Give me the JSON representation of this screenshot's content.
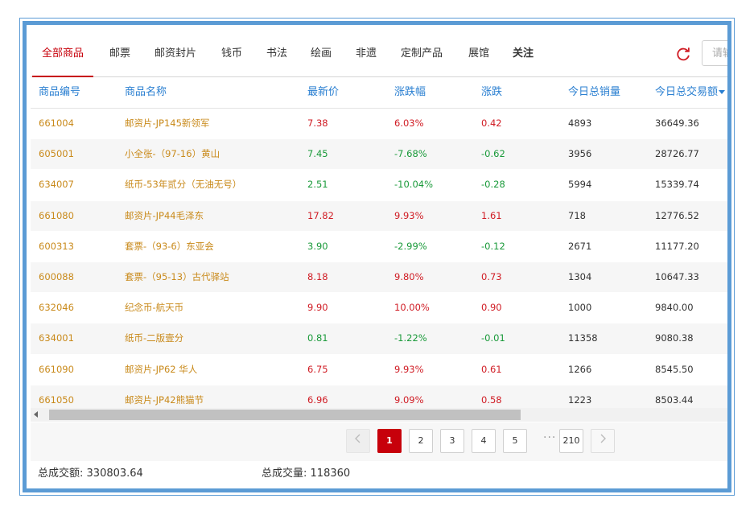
{
  "tabs": [
    "全部商品",
    "邮票",
    "邮资封片",
    "钱币",
    "书法",
    "绘画",
    "非遗",
    "定制产品",
    "展馆",
    "关注"
  ],
  "search": {
    "placeholder": "请输入"
  },
  "icons": {
    "refresh": "refresh-icon",
    "sort": "caret-down-icon",
    "prev": "chevron-left-icon",
    "next": "chevron-right-icon"
  },
  "colors": {
    "accent": "#c7000b",
    "header": "#2a7fd1",
    "up": "#d01c24",
    "down": "#1a9a3a",
    "code": "#c98a1b",
    "frame": "#5b9bd5"
  },
  "table": {
    "columns": [
      "商品编号",
      "商品名称",
      "最新价",
      "涨跌幅",
      "涨跌",
      "今日总销量",
      "今日总交易额"
    ],
    "rows": [
      {
        "code": "661004",
        "name": "邮资片-JP145新领军",
        "price": "7.38",
        "pct": "6.03%",
        "chg": "0.42",
        "vol": "4893",
        "amt": "36649.36",
        "dir": "up"
      },
      {
        "code": "605001",
        "name": "小全张-（97-16）黄山",
        "price": "7.45",
        "pct": "-7.68%",
        "chg": "-0.62",
        "vol": "3956",
        "amt": "28726.77",
        "dir": "down"
      },
      {
        "code": "634007",
        "name": "纸币-53年贰分（无油无号）",
        "price": "2.51",
        "pct": "-10.04%",
        "chg": "-0.28",
        "vol": "5994",
        "amt": "15339.74",
        "dir": "down"
      },
      {
        "code": "661080",
        "name": "邮资片-JP44毛泽东",
        "price": "17.82",
        "pct": "9.93%",
        "chg": "1.61",
        "vol": "718",
        "amt": "12776.52",
        "dir": "up"
      },
      {
        "code": "600313",
        "name": "套票-（93-6）东亚会",
        "price": "3.90",
        "pct": "-2.99%",
        "chg": "-0.12",
        "vol": "2671",
        "amt": "11177.20",
        "dir": "down"
      },
      {
        "code": "600088",
        "name": "套票-（95-13）古代驿站",
        "price": "8.18",
        "pct": "9.80%",
        "chg": "0.73",
        "vol": "1304",
        "amt": "10647.33",
        "dir": "up"
      },
      {
        "code": "632046",
        "name": "纪念币-航天币",
        "price": "9.90",
        "pct": "10.00%",
        "chg": "0.90",
        "vol": "1000",
        "amt": "9840.00",
        "dir": "up"
      },
      {
        "code": "634001",
        "name": "纸币-二版壹分",
        "price": "0.81",
        "pct": "-1.22%",
        "chg": "-0.01",
        "vol": "11358",
        "amt": "9080.38",
        "dir": "down"
      },
      {
        "code": "661090",
        "name": "邮资片-JP62 华人",
        "price": "6.75",
        "pct": "9.93%",
        "chg": "0.61",
        "vol": "1266",
        "amt": "8545.50",
        "dir": "up"
      },
      {
        "code": "661050",
        "name": "邮资片-JP42熊猫节",
        "price": "6.96",
        "pct": "9.09%",
        "chg": "0.58",
        "vol": "1223",
        "amt": "8503.44",
        "dir": "up"
      }
    ]
  },
  "pagination": {
    "pages": [
      "1",
      "2",
      "3",
      "4",
      "5"
    ],
    "ellipsis": "···",
    "last": "210",
    "current": "1"
  },
  "footer": {
    "turnover_label": "总成交额:",
    "turnover_value": "330803.64",
    "volume_label": "总成交量:",
    "volume_value": "118360"
  }
}
